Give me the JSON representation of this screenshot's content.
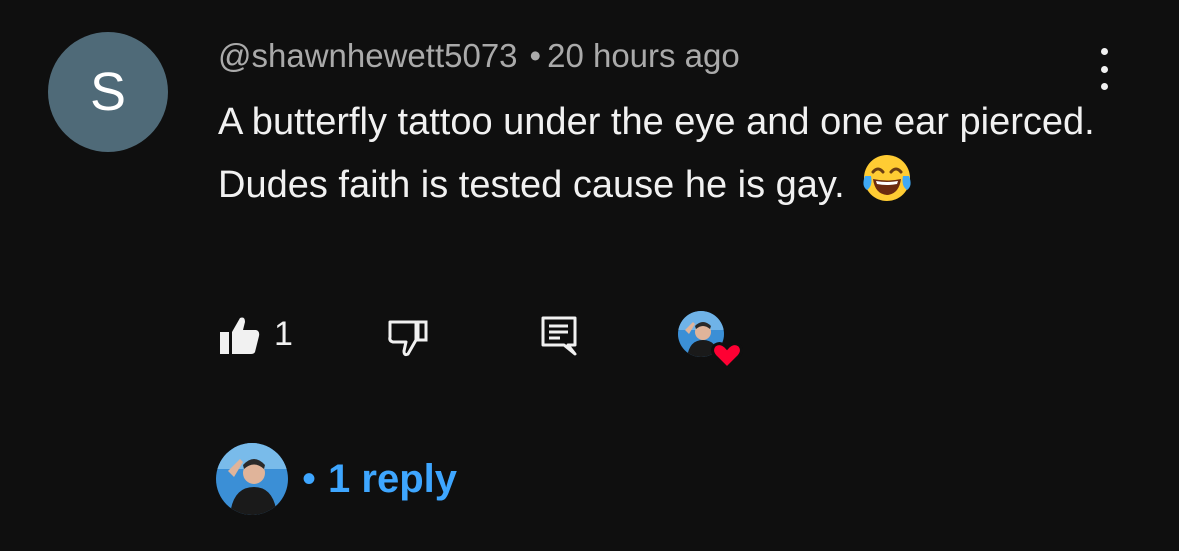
{
  "comment": {
    "author_initial": "S",
    "author_handle": "@shawnhewett5073",
    "separator": "•",
    "timestamp": "20 hours ago",
    "text": "A butterfly tattoo under the eye and one ear pierced. Dudes faith is tested cause he is gay.",
    "emoji": "face-with-tears-of-joy",
    "avatar_color": "#4f6a78"
  },
  "actions": {
    "like_count": "1",
    "liked_by_creator": true,
    "heart_color": "#ff0033"
  },
  "replies": {
    "bullet": "•",
    "label": "1 reply",
    "link_color": "#3ea6ff"
  }
}
